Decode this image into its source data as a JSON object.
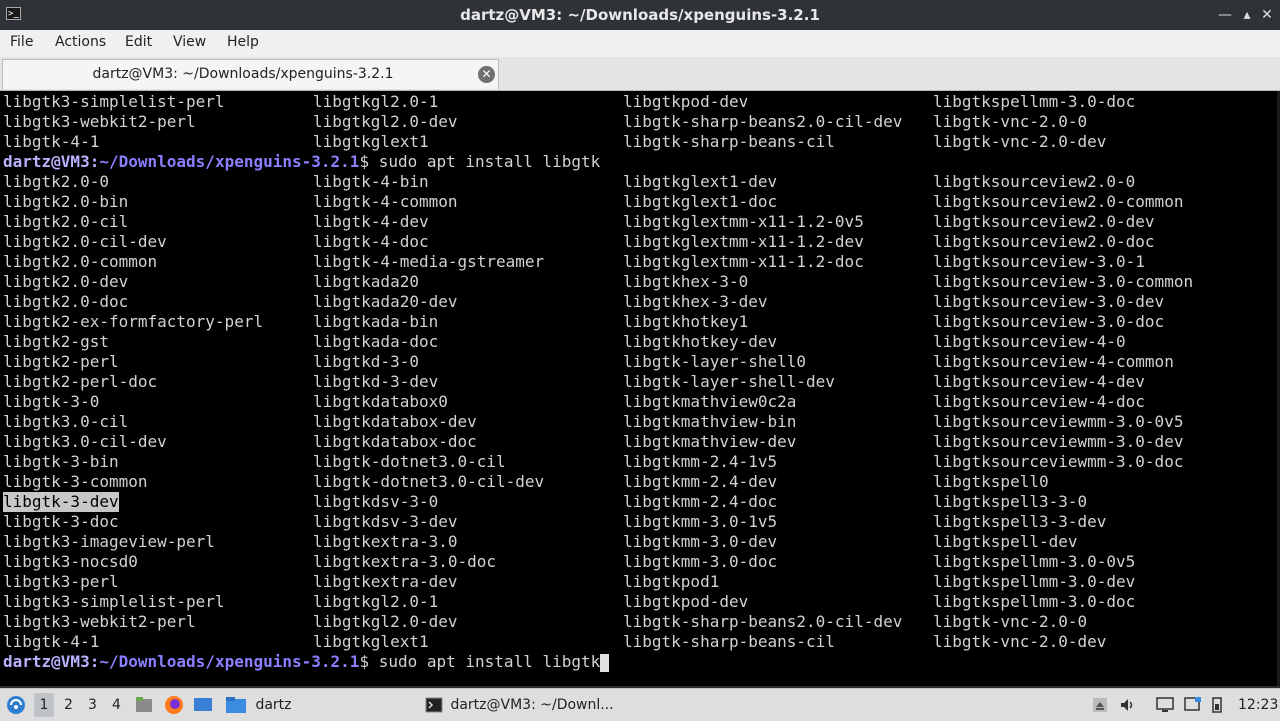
{
  "window": {
    "title": "dartz@VM3: ~/Downloads/xpenguins-3.2.1"
  },
  "menu": [
    "File",
    "Actions",
    "Edit",
    "View",
    "Help"
  ],
  "tab": {
    "label": "dartz@VM3: ~/Downloads/xpenguins-3.2.1"
  },
  "terminal": {
    "prompt_user": "dartz@VM3",
    "prompt_path": "~/Downloads/xpenguins-3.2.1",
    "command": "sudo apt install libgtk",
    "top_rows": [
      [
        "libgtk3-simplelist-perl",
        "libgtkgl2.0-1",
        "libgtkpod-dev",
        "libgtkspellmm-3.0-doc"
      ],
      [
        "libgtk3-webkit2-perl",
        "libgtkgl2.0-dev",
        "libgtk-sharp-beans2.0-cil-dev",
        "libgtk-vnc-2.0-0"
      ],
      [
        "libgtk-4-1",
        "libgtkglext1",
        "libgtk-sharp-beans-cil",
        "libgtk-vnc-2.0-dev"
      ]
    ],
    "rows": [
      [
        "libgtk2.0-0",
        "libgtk-4-bin",
        "libgtkglext1-dev",
        "libgtksourceview2.0-0"
      ],
      [
        "libgtk2.0-bin",
        "libgtk-4-common",
        "libgtkglext1-doc",
        "libgtksourceview2.0-common"
      ],
      [
        "libgtk2.0-cil",
        "libgtk-4-dev",
        "libgtkglextmm-x11-1.2-0v5",
        "libgtksourceview2.0-dev"
      ],
      [
        "libgtk2.0-cil-dev",
        "libgtk-4-doc",
        "libgtkglextmm-x11-1.2-dev",
        "libgtksourceview2.0-doc"
      ],
      [
        "libgtk2.0-common",
        "libgtk-4-media-gstreamer",
        "libgtkglextmm-x11-1.2-doc",
        "libgtksourceview-3.0-1"
      ],
      [
        "libgtk2.0-dev",
        "libgtkada20",
        "libgtkhex-3-0",
        "libgtksourceview-3.0-common"
      ],
      [
        "libgtk2.0-doc",
        "libgtkada20-dev",
        "libgtkhex-3-dev",
        "libgtksourceview-3.0-dev"
      ],
      [
        "libgtk2-ex-formfactory-perl",
        "libgtkada-bin",
        "libgtkhotkey1",
        "libgtksourceview-3.0-doc"
      ],
      [
        "libgtk2-gst",
        "libgtkada-doc",
        "libgtkhotkey-dev",
        "libgtksourceview-4-0"
      ],
      [
        "libgtk2-perl",
        "libgtkd-3-0",
        "libgtk-layer-shell0",
        "libgtksourceview-4-common"
      ],
      [
        "libgtk2-perl-doc",
        "libgtkd-3-dev",
        "libgtk-layer-shell-dev",
        "libgtksourceview-4-dev"
      ],
      [
        "libgtk-3-0",
        "libgtkdatabox0",
        "libgtkmathview0c2a",
        "libgtksourceview-4-doc"
      ],
      [
        "libgtk3.0-cil",
        "libgtkdatabox-dev",
        "libgtkmathview-bin",
        "libgtksourceviewmm-3.0-0v5"
      ],
      [
        "libgtk3.0-cil-dev",
        "libgtkdatabox-doc",
        "libgtkmathview-dev",
        "libgtksourceviewmm-3.0-dev"
      ],
      [
        "libgtk-3-bin",
        "libgtk-dotnet3.0-cil",
        "libgtkmm-2.4-1v5",
        "libgtksourceviewmm-3.0-doc"
      ],
      [
        "libgtk-3-common",
        "libgtk-dotnet3.0-cil-dev",
        "libgtkmm-2.4-dev",
        "libgtkspell0"
      ],
      [
        "libgtk-3-dev",
        "libgtkdsv-3-0",
        "libgtkmm-2.4-doc",
        "libgtkspell3-3-0"
      ],
      [
        "libgtk-3-doc",
        "libgtkdsv-3-dev",
        "libgtkmm-3.0-1v5",
        "libgtkspell3-3-dev"
      ],
      [
        "libgtk3-imageview-perl",
        "libgtkextra-3.0",
        "libgtkmm-3.0-dev",
        "libgtkspell-dev"
      ],
      [
        "libgtk3-nocsd0",
        "libgtkextra-3.0-doc",
        "libgtkmm-3.0-doc",
        "libgtkspellmm-3.0-0v5"
      ],
      [
        "libgtk3-perl",
        "libgtkextra-dev",
        "libgtkpod1",
        "libgtkspellmm-3.0-dev"
      ],
      [
        "libgtk3-simplelist-perl",
        "libgtkgl2.0-1",
        "libgtkpod-dev",
        "libgtkspellmm-3.0-doc"
      ],
      [
        "libgtk3-webkit2-perl",
        "libgtkgl2.0-dev",
        "libgtk-sharp-beans2.0-cil-dev",
        "libgtk-vnc-2.0-0"
      ],
      [
        "libgtk-4-1",
        "libgtkglext1",
        "libgtk-sharp-beans-cil",
        "libgtk-vnc-2.0-dev"
      ]
    ],
    "selected_text": "libgtk-3-dev"
  },
  "taskbar": {
    "workspaces": [
      "1",
      "2",
      "3",
      "4"
    ],
    "active_workspace": "1",
    "folder_label": "dartz",
    "task_label": "dartz@VM3: ~/Downl...",
    "clock": "12:23",
    "icons": [
      "start-menu-icon",
      "file-manager-icon",
      "firefox-icon",
      "desktop-icon",
      "folder-icon",
      "terminal-icon",
      "eject-icon",
      "volume-icon",
      "display-icon",
      "network-icon",
      "power-icon"
    ]
  },
  "colors": {
    "terminal_bg": "#000000",
    "terminal_fg": "#d2d2d2",
    "prompt_user": "#b9b2ff",
    "prompt_path": "#8a80ff",
    "titlebar_bg": "#2f3337"
  }
}
